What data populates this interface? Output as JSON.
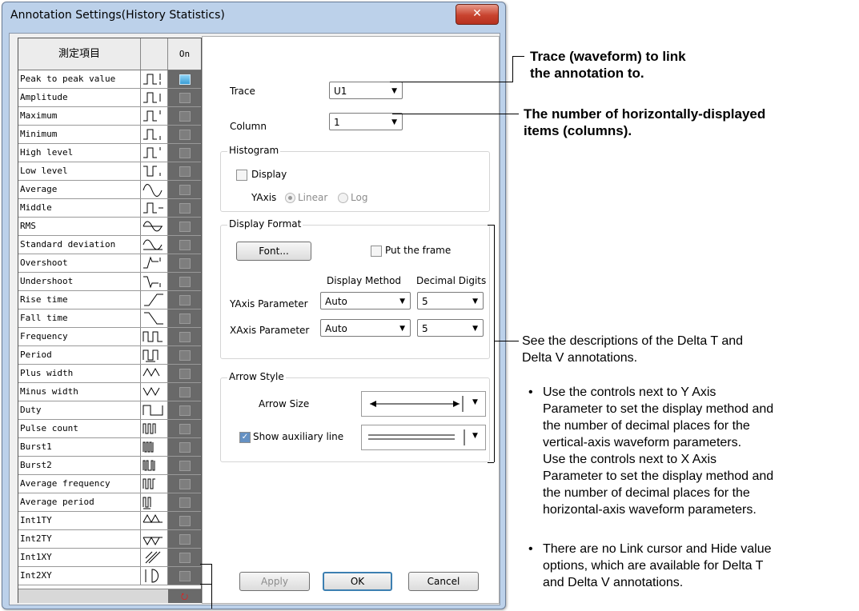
{
  "window": {
    "title": "Annotation Settings(History Statistics)",
    "close_glyph": "✕"
  },
  "list": {
    "header_name": "測定項目",
    "header_on": "On",
    "items": [
      {
        "label": "Peak to peak value",
        "on": true
      },
      {
        "label": "Amplitude",
        "on": false
      },
      {
        "label": "Maximum",
        "on": false
      },
      {
        "label": "Minimum",
        "on": false
      },
      {
        "label": "High level",
        "on": false
      },
      {
        "label": "Low level",
        "on": false
      },
      {
        "label": "Average",
        "on": false
      },
      {
        "label": "Middle",
        "on": false
      },
      {
        "label": "RMS",
        "on": false
      },
      {
        "label": "Standard deviation",
        "on": false
      },
      {
        "label": "Overshoot",
        "on": false
      },
      {
        "label": "Undershoot",
        "on": false
      },
      {
        "label": "Rise time",
        "on": false
      },
      {
        "label": "Fall time",
        "on": false
      },
      {
        "label": "Frequency",
        "on": false
      },
      {
        "label": "Period",
        "on": false
      },
      {
        "label": "Plus width",
        "on": false
      },
      {
        "label": "Minus width",
        "on": false
      },
      {
        "label": "Duty",
        "on": false
      },
      {
        "label": "Pulse count",
        "on": false
      },
      {
        "label": "Burst1",
        "on": false
      },
      {
        "label": "Burst2",
        "on": false
      },
      {
        "label": "Average frequency",
        "on": false
      },
      {
        "label": "Average period",
        "on": false
      },
      {
        "label": "Int1TY",
        "on": false
      },
      {
        "label": "Int2TY",
        "on": false
      },
      {
        "label": "Int1XY",
        "on": false
      },
      {
        "label": "Int2XY",
        "on": false
      }
    ],
    "footer_icon": "reset-icon"
  },
  "settings": {
    "trace_label": "Trace",
    "trace_value": "U1",
    "column_label": "Column",
    "column_value": "1",
    "histogram": {
      "title": "Histogram",
      "display_label": "Display",
      "yaxis_label": "YAxis",
      "linear": "Linear",
      "log": "Log"
    },
    "display_format": {
      "title": "Display Format",
      "font_button": "Font...",
      "frame_label": "Put the frame",
      "method_header": "Display Method",
      "digits_header": "Decimal Digits",
      "y_label": "YAxis Parameter",
      "y_method": "Auto",
      "y_digits": "5",
      "x_label": "XAxis Parameter",
      "x_method": "Auto",
      "x_digits": "5"
    },
    "arrow_style": {
      "title": "Arrow Style",
      "size_label": "Arrow Size",
      "aux_label": "Show auxiliary line",
      "aux_checked": true
    },
    "buttons": {
      "apply": "Apply",
      "ok": "OK",
      "cancel": "Cancel"
    }
  },
  "annotations": {
    "trace_1": "Trace (waveform) to link",
    "trace_2": "the annotation to.",
    "column_1": "The number of horizontally-displayed",
    "column_2": "items (columns).",
    "see_1": "See the descriptions of the Delta T and",
    "see_2": "Delta V annotations.",
    "b1": [
      "Use the controls next to Y Axis",
      "Parameter to set the display method and",
      "the number of decimal places for the",
      "vertical-axis waveform parameters.",
      "Use the controls next to X Axis",
      "Parameter to set the display method and",
      "the number of decimal places for the",
      "horizontal-axis waveform parameters."
    ],
    "b2": [
      "There are no Link cursor and Hide value",
      "options, which are available for Delta T",
      "and Delta V annotations."
    ],
    "bullet": "•"
  }
}
